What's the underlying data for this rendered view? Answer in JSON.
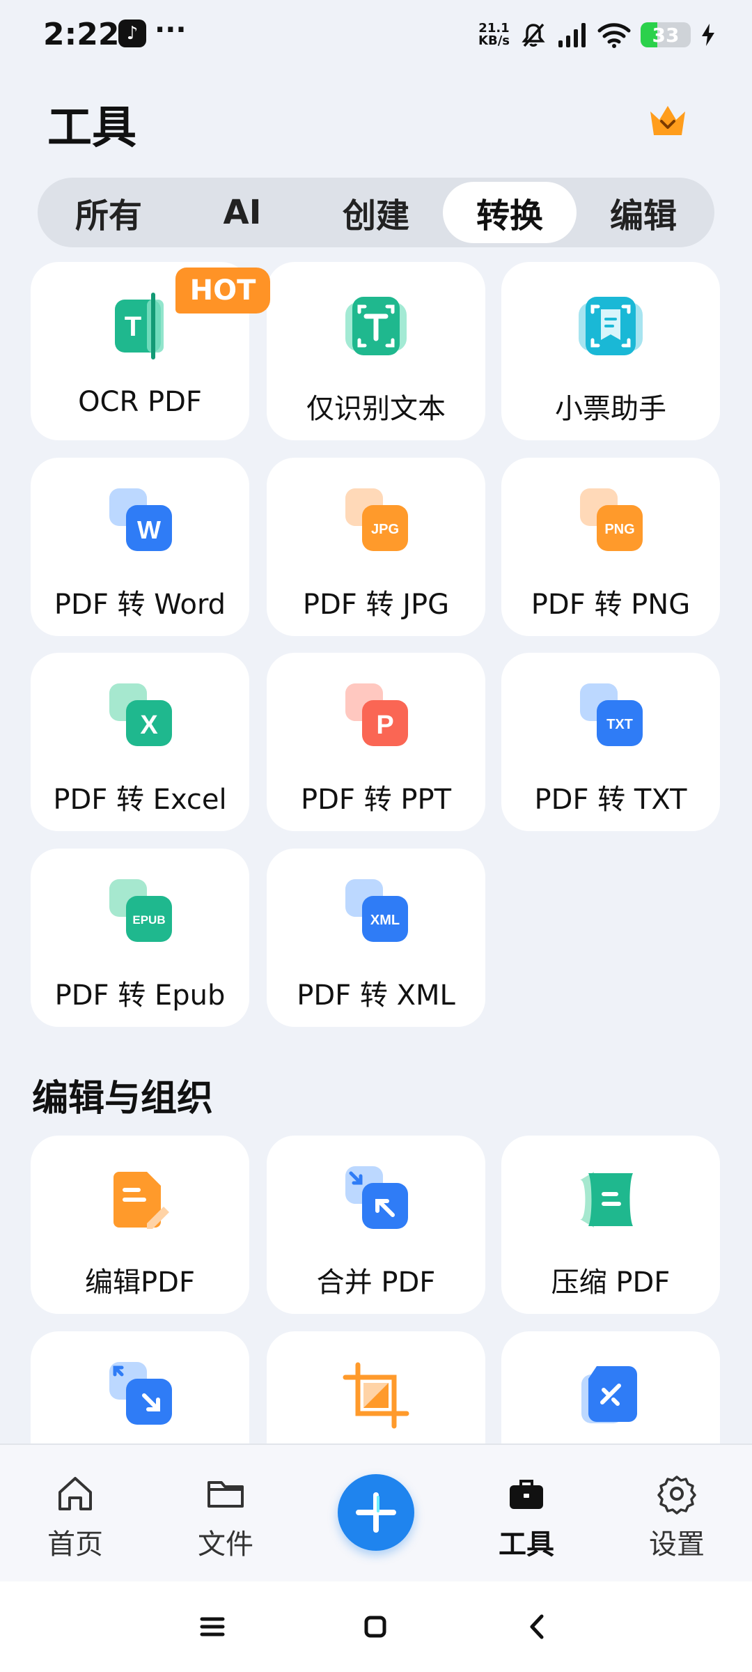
{
  "status_bar": {
    "time": "2:22",
    "app_icon": "tiktok-icon",
    "more": "···",
    "net_speed_value": "21.1",
    "net_speed_unit": "KB/s",
    "battery": "33",
    "battery_level_percent": 33,
    "battery_color": "#2bd14b"
  },
  "header": {
    "title": "工具",
    "premium_icon": "crown-icon"
  },
  "tabs": [
    {
      "label": "所有",
      "active": false
    },
    {
      "label": "AI",
      "active": false
    },
    {
      "label": "创建",
      "active": false
    },
    {
      "label": "转换",
      "active": true
    },
    {
      "label": "编辑",
      "active": false
    }
  ],
  "hot_badge": "HOT",
  "convert_tools": [
    {
      "label": "OCR PDF",
      "icon": "ocr-pdf-icon"
    },
    {
      "label": "仅识别文本",
      "icon": "text-recognition-icon"
    },
    {
      "label": "小票助手",
      "icon": "receipt-scan-icon"
    },
    {
      "label": "PDF 转 Word",
      "icon": "word-doc-icon",
      "badge": "W"
    },
    {
      "label": "PDF 转 JPG",
      "icon": "jpg-image-icon",
      "badge": "JPG"
    },
    {
      "label": "PDF 转 PNG",
      "icon": "png-image-icon",
      "badge": "PNG"
    },
    {
      "label": "PDF 转 Excel",
      "icon": "excel-sheet-icon",
      "badge": "X"
    },
    {
      "label": "PDF 转 PPT",
      "icon": "ppt-slides-icon",
      "badge": "P"
    },
    {
      "label": "PDF 转 TXT",
      "icon": "txt-file-icon",
      "badge": "TXT"
    },
    {
      "label": "PDF 转 Epub",
      "icon": "epub-book-icon",
      "badge": "EPUB"
    },
    {
      "label": "PDF 转 XML",
      "icon": "xml-file-icon",
      "badge": "XML"
    }
  ],
  "edit_section": {
    "title": "编辑与组织",
    "tools": [
      {
        "label": "编辑PDF",
        "icon": "edit-pdf-icon"
      },
      {
        "label": "合并 PDF",
        "icon": "merge-pdf-icon"
      },
      {
        "label": "压缩 PDF",
        "icon": "compress-pdf-icon"
      },
      {
        "label": "",
        "icon": "split-pdf-icon"
      },
      {
        "label": "",
        "icon": "crop-pdf-icon"
      },
      {
        "label": "",
        "icon": "sign-pdf-icon"
      }
    ]
  },
  "bottom_nav": [
    {
      "label": "首页",
      "icon": "home-icon",
      "active": false
    },
    {
      "label": "文件",
      "icon": "folder-icon",
      "active": false
    },
    {
      "label": "",
      "icon": "plus-icon",
      "fab": true
    },
    {
      "label": "工具",
      "icon": "toolbox-icon",
      "active": true
    },
    {
      "label": "设置",
      "icon": "gear-icon",
      "active": false
    }
  ],
  "system_nav": [
    "menu-icon",
    "home-square-icon",
    "back-chevron-icon"
  ],
  "colors": {
    "background": "#eff2f8",
    "accent_blue": "#1f84ee",
    "hot_orange": "#ff9326",
    "teal": "#1fb88e",
    "orange": "#ff9a2b"
  }
}
